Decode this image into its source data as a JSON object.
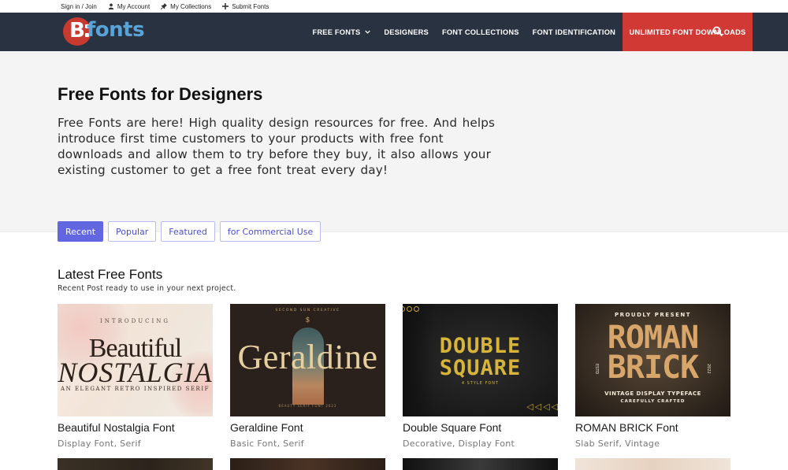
{
  "topbar": {
    "sign_in": "Sign in / Join",
    "my_account": "My Account",
    "my_collections": "My Collections",
    "submit_fonts": "Submit Fonts"
  },
  "logo": {
    "badge": "B",
    "wordmark": "fonts"
  },
  "nav": {
    "free_fonts": "FREE FONTS",
    "designers": "DESIGNERS",
    "font_collections": "FONT COLLECTIONS",
    "font_identification": "FONT IDENTIFICATION",
    "unlimited": "UNLIMITED FONT DOWNLOADS"
  },
  "colors": {
    "nav_bg": "#283241",
    "cta_bg": "#d13a34",
    "tab_active": "#6266e0",
    "hero_bg": "#f4f4f4"
  },
  "hero": {
    "title": "Free Fonts for Designers",
    "text": "Free Fonts are here! High quality design resources for free. And helps introduce first time customers to your products with free font downloads and allow them to try before they buy, it also allows your existing customer to get a free font treat every day!"
  },
  "tabs": [
    "Recent",
    "Popular",
    "Featured",
    "for Commercial Use"
  ],
  "latest": {
    "title": "Latest Free Fonts",
    "subtitle": "Recent Post ready to use in your next project."
  },
  "cards": [
    {
      "title": "Beautiful Nostalgia Font",
      "tags": "Display Font, Serif",
      "thumb": {
        "intro": "INTRODUCING",
        "line1": "Beautiful",
        "line2": "NOSTALGIA",
        "tagline": "AN ELEGANT RETRO INSPIRED SERIF"
      }
    },
    {
      "title": "Geraldine Font",
      "tags": "Basic Font, Serif",
      "thumb": {
        "top": "SECOND SUN CREATIVE",
        "mark": "$",
        "name": "Geraldine",
        "foot": "BEAUTY SERIF FONT 2022"
      }
    },
    {
      "title": "Double Square Font",
      "tags": "Decorative, Display Font",
      "thumb": {
        "line1": "DOUBLE",
        "line2": "SQUARE",
        "sub": "4 STYLE FONT"
      }
    },
    {
      "title": "ROMAN BRICK Font",
      "tags": "Slab Serif, Vintage",
      "thumb": {
        "arc": "PROUDLY PRESENT",
        "line1": "ROMAN",
        "line2": "BRICK",
        "desc": "VINTAGE DISPLAY TYPEFACE",
        "crafted": "CAREFULLY CRAFTED",
        "left_side": "ESTD",
        "right_side": "2022"
      }
    }
  ]
}
